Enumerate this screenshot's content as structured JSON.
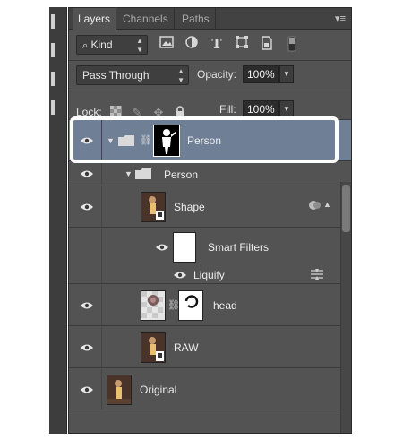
{
  "tabs": [
    {
      "label": "Layers",
      "active": true
    },
    {
      "label": "Channels",
      "active": false
    },
    {
      "label": "Paths",
      "active": false
    }
  ],
  "panel_menu_icon": "panel-menu-icon",
  "filter": {
    "kind_label": "Kind",
    "icons": [
      "pixel-filter-icon",
      "adjustment-filter-icon",
      "type-filter-icon",
      "shape-filter-icon",
      "smart-object-filter-icon",
      "filter-toggle-icon"
    ]
  },
  "blend": {
    "mode": "Pass Through",
    "opacity_label": "Opacity:",
    "opacity_value": "100%"
  },
  "lock": {
    "label": "Lock:",
    "fill_label": "Fill:",
    "fill_value": "100%"
  },
  "layers": [
    {
      "name": "Person",
      "type": "group-with-mask",
      "selected": true
    },
    {
      "name": "Person",
      "type": "group"
    },
    {
      "name": "Shape",
      "type": "smart-object"
    },
    {
      "name": "Smart Filters",
      "type": "smart-filters"
    },
    {
      "name": "Liquify",
      "type": "filter"
    },
    {
      "name": "head",
      "type": "layer-with-mask"
    },
    {
      "name": "RAW",
      "type": "smart-object"
    },
    {
      "name": "Original",
      "type": "layer"
    }
  ]
}
